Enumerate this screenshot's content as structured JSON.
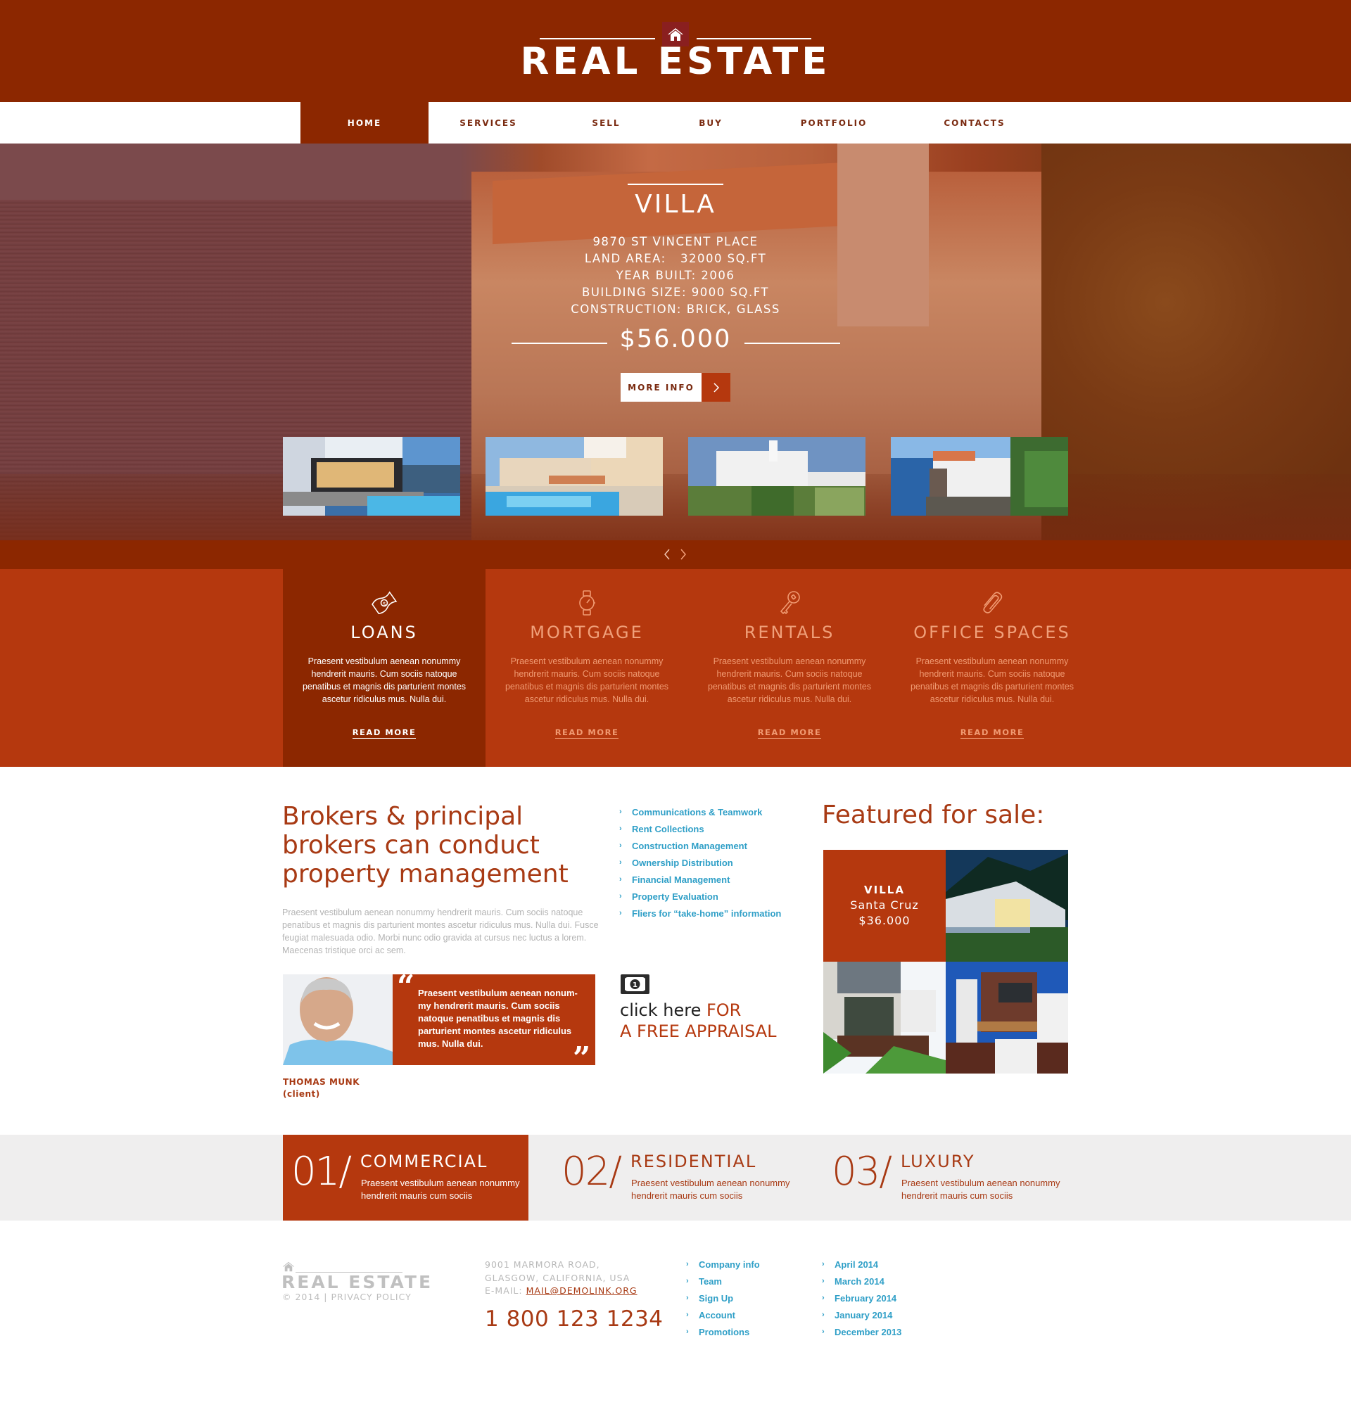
{
  "brand": {
    "name": "REAL ESTATE",
    "icon": "house-icon",
    "primary_color": "#8c2700",
    "accent_color": "#b5380e",
    "link_color": "#2f9fc7"
  },
  "nav": {
    "items": [
      {
        "label": "HOME",
        "active": true
      },
      {
        "label": "SERVICES",
        "active": false
      },
      {
        "label": "SELL",
        "active": false
      },
      {
        "label": "BUY",
        "active": false
      },
      {
        "label": "PORTFOLIO",
        "active": false
      },
      {
        "label": "CONTACTS",
        "active": false
      }
    ]
  },
  "hero": {
    "title": "VILLA",
    "details": [
      "9870 ST VINCENT PLACE",
      "LAND AREA:   32000 SQ.FT",
      "YEAR BUILT: 2006",
      "BUILDING SIZE: 9000 SQ.FT",
      "CONSTRUCTION: BRICK, GLASS"
    ],
    "price": "$56.000",
    "button_label": "MORE INFO",
    "button_icon": "chevron-right-icon",
    "thumbnails": [
      "modern-house-pool",
      "villa-pool-terrace",
      "white-villa-garden",
      "seaside-villa"
    ],
    "slider_prev_icon": "chevron-left-icon",
    "slider_next_icon": "chevron-right-icon"
  },
  "services": [
    {
      "title": "LOANS",
      "icon": "money-bill-icon",
      "text": "Praesent vestibulum aenean nonummy hendrerit mauris. Cum sociis natoque penatibus et magnis dis parturient montes ascetur ridiculus mus. Nulla dui.",
      "link": "READ MORE",
      "active": true
    },
    {
      "title": "MORTGAGE",
      "icon": "watch-icon",
      "text": "Praesent vestibulum aenean nonummy hendrerit mauris. Cum sociis natoque penatibus et magnis dis parturient montes ascetur ridiculus mus. Nulla dui.",
      "link": "READ MORE",
      "active": false
    },
    {
      "title": "RENTALS",
      "icon": "key-icon",
      "text": "Praesent vestibulum aenean nonummy hendrerit mauris. Cum sociis natoque penatibus et magnis dis parturient montes ascetur ridiculus mus. Nulla dui.",
      "link": "READ MORE",
      "active": false
    },
    {
      "title": "OFFICE SPACES",
      "icon": "paperclip-icon",
      "text": "Praesent vestibulum aenean nonummy hendrerit mauris. Cum sociis natoque penatibus et magnis dis parturient montes ascetur ridiculus mus. Nulla dui.",
      "link": "READ MORE",
      "active": false
    }
  ],
  "brokers": {
    "title": "Brokers & principal brokers can conduct property management",
    "text": "Praesent vestibulum aenean nonummy hendrerit mauris. Cum sociis natoque penatibus et magnis dis parturient montes ascetur ridiculus mus. Nulla dui. Fusce feugiat malesuada odio. Morbi nunc odio gravida at cursus nec luctus a lorem. Maecenas tristique orci ac sem."
  },
  "features": [
    "Communications & Teamwork",
    "Rent Collections",
    "Construction Management",
    "Ownership Distribution",
    "Financial Management",
    "Property Evaluation",
    "Fliers for “take-home” information"
  ],
  "testimonial": {
    "text": "Praesent vestibulum aenean nonum-my hendrerit mauris. Cum sociis natoque penatibus et magnis dis parturient montes ascetur ridiculus mus. Nulla dui.",
    "name": "THOMAS MUNK",
    "role": "(client)",
    "open_quote": "“",
    "close_quote": "”"
  },
  "appraisal": {
    "icon": "money-bill-icon",
    "lead": "click here ",
    "accent_1": "FOR",
    "accent_2": "A FREE APPRAISAL"
  },
  "featured": {
    "title": "Featured for sale:",
    "card": {
      "type": "VILLA",
      "location": "Santa Cruz",
      "price": "$36.000"
    },
    "images": [
      "modern-villa-night",
      "house-deck-garden",
      "brick-modern-house"
    ]
  },
  "categories": [
    {
      "num": "01/",
      "title": "COMMERCIAL",
      "text": "Praesent vestibulum aenean nonummy hendrerit mauris cum sociis",
      "active": true
    },
    {
      "num": "02/",
      "title": "RESIDENTIAL",
      "text": "Praesent vestibulum aenean nonummy hendrerit mauris cum sociis",
      "active": false
    },
    {
      "num": "03/",
      "title": "LUXURY",
      "text": "Praesent vestibulum aenean nonummy hendrerit mauris cum sociis",
      "active": false
    }
  ],
  "footer": {
    "logo": "REAL ESTATE",
    "copyright": "© 2014 | ",
    "privacy": "PRIVACY POLICY",
    "address_1": "9001 MARMORA ROAD,",
    "address_2": "GLASGOW, CALIFORNIA, USA",
    "email_label": "E-MAIL: ",
    "email": "MAIL@DEMOLINK.ORG",
    "phone": "1 800 123 1234",
    "links": [
      "Company info",
      "Team",
      "Sign Up",
      "Account",
      "Promotions"
    ],
    "archive": [
      "April 2014",
      "March 2014",
      "February 2014",
      "January 2014",
      "December 2013"
    ]
  }
}
